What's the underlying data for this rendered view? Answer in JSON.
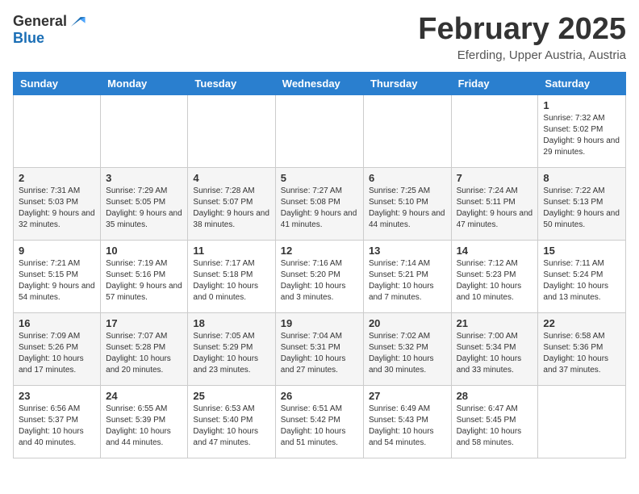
{
  "header": {
    "logo_line1": "General",
    "logo_line2": "Blue",
    "month": "February 2025",
    "location": "Eferding, Upper Austria, Austria"
  },
  "weekdays": [
    "Sunday",
    "Monday",
    "Tuesday",
    "Wednesday",
    "Thursday",
    "Friday",
    "Saturday"
  ],
  "weeks": [
    [
      {
        "day": "",
        "info": ""
      },
      {
        "day": "",
        "info": ""
      },
      {
        "day": "",
        "info": ""
      },
      {
        "day": "",
        "info": ""
      },
      {
        "day": "",
        "info": ""
      },
      {
        "day": "",
        "info": ""
      },
      {
        "day": "1",
        "info": "Sunrise: 7:32 AM\nSunset: 5:02 PM\nDaylight: 9 hours and 29 minutes."
      }
    ],
    [
      {
        "day": "2",
        "info": "Sunrise: 7:31 AM\nSunset: 5:03 PM\nDaylight: 9 hours and 32 minutes."
      },
      {
        "day": "3",
        "info": "Sunrise: 7:29 AM\nSunset: 5:05 PM\nDaylight: 9 hours and 35 minutes."
      },
      {
        "day": "4",
        "info": "Sunrise: 7:28 AM\nSunset: 5:07 PM\nDaylight: 9 hours and 38 minutes."
      },
      {
        "day": "5",
        "info": "Sunrise: 7:27 AM\nSunset: 5:08 PM\nDaylight: 9 hours and 41 minutes."
      },
      {
        "day": "6",
        "info": "Sunrise: 7:25 AM\nSunset: 5:10 PM\nDaylight: 9 hours and 44 minutes."
      },
      {
        "day": "7",
        "info": "Sunrise: 7:24 AM\nSunset: 5:11 PM\nDaylight: 9 hours and 47 minutes."
      },
      {
        "day": "8",
        "info": "Sunrise: 7:22 AM\nSunset: 5:13 PM\nDaylight: 9 hours and 50 minutes."
      }
    ],
    [
      {
        "day": "9",
        "info": "Sunrise: 7:21 AM\nSunset: 5:15 PM\nDaylight: 9 hours and 54 minutes."
      },
      {
        "day": "10",
        "info": "Sunrise: 7:19 AM\nSunset: 5:16 PM\nDaylight: 9 hours and 57 minutes."
      },
      {
        "day": "11",
        "info": "Sunrise: 7:17 AM\nSunset: 5:18 PM\nDaylight: 10 hours and 0 minutes."
      },
      {
        "day": "12",
        "info": "Sunrise: 7:16 AM\nSunset: 5:20 PM\nDaylight: 10 hours and 3 minutes."
      },
      {
        "day": "13",
        "info": "Sunrise: 7:14 AM\nSunset: 5:21 PM\nDaylight: 10 hours and 7 minutes."
      },
      {
        "day": "14",
        "info": "Sunrise: 7:12 AM\nSunset: 5:23 PM\nDaylight: 10 hours and 10 minutes."
      },
      {
        "day": "15",
        "info": "Sunrise: 7:11 AM\nSunset: 5:24 PM\nDaylight: 10 hours and 13 minutes."
      }
    ],
    [
      {
        "day": "16",
        "info": "Sunrise: 7:09 AM\nSunset: 5:26 PM\nDaylight: 10 hours and 17 minutes."
      },
      {
        "day": "17",
        "info": "Sunrise: 7:07 AM\nSunset: 5:28 PM\nDaylight: 10 hours and 20 minutes."
      },
      {
        "day": "18",
        "info": "Sunrise: 7:05 AM\nSunset: 5:29 PM\nDaylight: 10 hours and 23 minutes."
      },
      {
        "day": "19",
        "info": "Sunrise: 7:04 AM\nSunset: 5:31 PM\nDaylight: 10 hours and 27 minutes."
      },
      {
        "day": "20",
        "info": "Sunrise: 7:02 AM\nSunset: 5:32 PM\nDaylight: 10 hours and 30 minutes."
      },
      {
        "day": "21",
        "info": "Sunrise: 7:00 AM\nSunset: 5:34 PM\nDaylight: 10 hours and 33 minutes."
      },
      {
        "day": "22",
        "info": "Sunrise: 6:58 AM\nSunset: 5:36 PM\nDaylight: 10 hours and 37 minutes."
      }
    ],
    [
      {
        "day": "23",
        "info": "Sunrise: 6:56 AM\nSunset: 5:37 PM\nDaylight: 10 hours and 40 minutes."
      },
      {
        "day": "24",
        "info": "Sunrise: 6:55 AM\nSunset: 5:39 PM\nDaylight: 10 hours and 44 minutes."
      },
      {
        "day": "25",
        "info": "Sunrise: 6:53 AM\nSunset: 5:40 PM\nDaylight: 10 hours and 47 minutes."
      },
      {
        "day": "26",
        "info": "Sunrise: 6:51 AM\nSunset: 5:42 PM\nDaylight: 10 hours and 51 minutes."
      },
      {
        "day": "27",
        "info": "Sunrise: 6:49 AM\nSunset: 5:43 PM\nDaylight: 10 hours and 54 minutes."
      },
      {
        "day": "28",
        "info": "Sunrise: 6:47 AM\nSunset: 5:45 PM\nDaylight: 10 hours and 58 minutes."
      },
      {
        "day": "",
        "info": ""
      }
    ]
  ]
}
